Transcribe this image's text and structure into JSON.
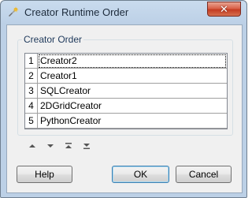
{
  "window": {
    "title": "Creator Runtime Order",
    "close_glyph": "✕"
  },
  "group": {
    "label": "Creator Order"
  },
  "list": {
    "rows": [
      {
        "index": "1",
        "name": "Creator2",
        "selected": true
      },
      {
        "index": "2",
        "name": "Creator1",
        "selected": false
      },
      {
        "index": "3",
        "name": "SQLCreator",
        "selected": false
      },
      {
        "index": "4",
        "name": "2DGridCreator",
        "selected": false
      },
      {
        "index": "5",
        "name": "PythonCreator",
        "selected": false
      }
    ]
  },
  "move_buttons": [
    {
      "name": "move-up-icon"
    },
    {
      "name": "move-down-icon"
    },
    {
      "name": "move-to-top-icon"
    },
    {
      "name": "move-to-bottom-icon"
    }
  ],
  "buttons": {
    "help": "Help",
    "ok": "OK",
    "cancel": "Cancel"
  },
  "colors": {
    "titlebar": "#bcd0e6",
    "close": "#c43b22",
    "dialog_bg": "#f0f0f0",
    "default_border": "#3c7fb1"
  }
}
